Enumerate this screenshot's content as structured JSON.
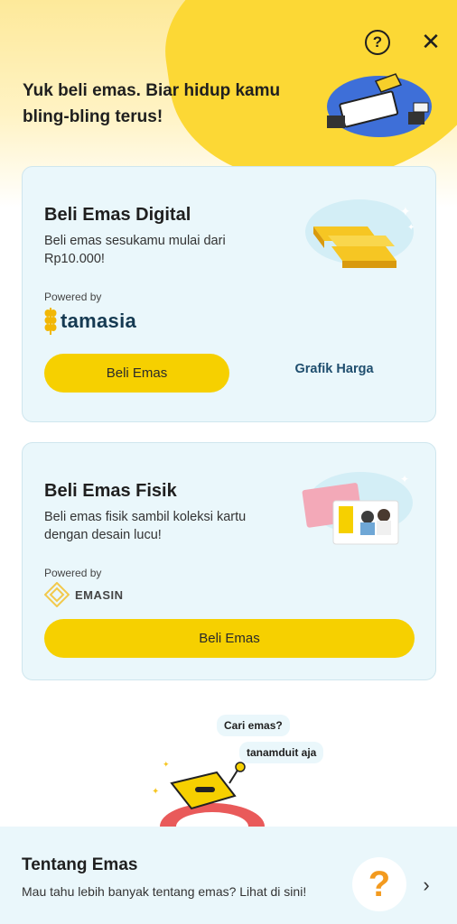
{
  "header": {
    "help_icon": "question-circle-icon",
    "close_icon": "close-icon",
    "title": "Yuk beli emas. Biar hidup kamu bling-bling terus!"
  },
  "digital": {
    "title": "Beli Emas Digital",
    "description": "Beli emas sesukamu mulai dari Rp10.000!",
    "powered_by": "Powered by",
    "partner": "tamasia",
    "buy_label": "Beli Emas",
    "chart_label": "Grafik Harga"
  },
  "physical": {
    "title": "Beli Emas Fisik",
    "description": "Beli emas fisik sambil koleksi kartu dengan desain lucu!",
    "powered_by": "Powered by",
    "partner": "EMASIN",
    "buy_label": "Beli Emas"
  },
  "chat": {
    "bubble_1": "Cari emas?",
    "bubble_2": "tanamduit aja"
  },
  "about": {
    "title": "Tentang Emas",
    "description": "Mau tahu lebih banyak tentang emas? Lihat di sini!",
    "question_mark": "?",
    "chevron_icon": "chevron-right-icon"
  },
  "colors": {
    "brand_yellow": "#f6d000",
    "card_bg": "#eaf7fb",
    "link_blue": "#1f4e6e"
  }
}
